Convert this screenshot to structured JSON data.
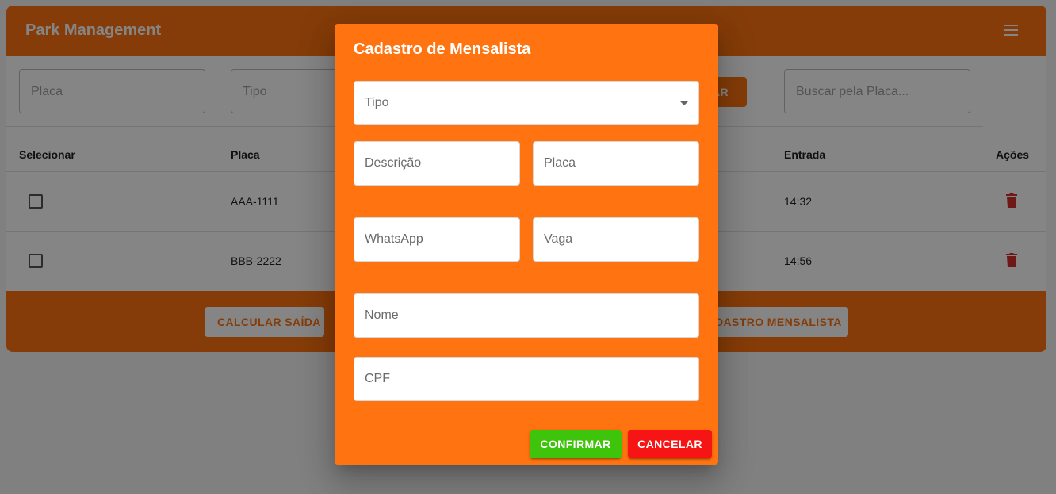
{
  "app": {
    "title": "Park Management",
    "menu_icon": "hamburger-menu-icon"
  },
  "filters": {
    "placa_placeholder": "Placa",
    "tipo_placeholder": "Tipo",
    "search_placeholder": "Buscar pela Placa...",
    "partial_button_label": "AR"
  },
  "table": {
    "headers": {
      "select": "Selecionar",
      "placa": "Placa",
      "entrada": "Entrada",
      "actions": "Ações"
    },
    "rows": [
      {
        "placa": "AAA-1111",
        "entrada": "14:32",
        "action_icon": "delete-icon"
      },
      {
        "placa": "BBB-2222",
        "entrada": "14:56",
        "action_icon": "delete-icon"
      }
    ]
  },
  "footer": {
    "calcular_saida_label": "CALCULAR SAÍDA",
    "cadastro_mensalista_partial_label": "DASTRO MENSALISTA"
  },
  "dialog": {
    "title": "Cadastro de Mensalista",
    "tipo_label": "Tipo",
    "descricao_label": "Descrição",
    "placa_label": "Placa",
    "whatsapp_label": "WhatsApp",
    "vaga_label": "Vaga",
    "nome_label": "Nome",
    "cpf_label": "CPF",
    "confirm_label": "CONFIRMAR",
    "cancel_label": "CANCELAR"
  },
  "colors": {
    "brand_orange": "#ff7410",
    "confirm_green": "#3ec40a",
    "cancel_red": "#f71414",
    "delete_red": "#d32f2f"
  }
}
